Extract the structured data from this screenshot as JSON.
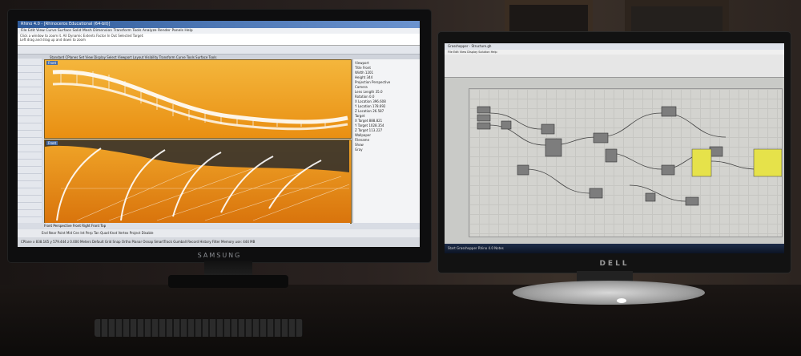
{
  "scene": {
    "description_type": "photo of two monitors on a desk",
    "left_monitor": {
      "brand": "SAMSUNG",
      "app_title": "Rhino 4.0 - [Rhinoceros Educational (64-bit)]",
      "menu": "File Edit View Curve Surface Solid Mesh Dimension Transform Tools Analyze Render Panels Help",
      "command_line_1": "Click a window to zoom it. All Dynamic Extents Factor In Out Selected Target:",
      "command_line_2": "Left drag and drag up and down to zoom",
      "command_label": "Command:",
      "tabs": "Standard  CPlanes  Set View  Display  Select  Viewport Layout  Visibility  Transform  Curve Tools  Surface Tools",
      "viewport_top_label": "Front",
      "viewport_bottom_label": "Front",
      "props_text": "Viewport\nTitle Front\nWidth 1201\nHeight 344\nProjection Perspective\nCamera\nLens Length 35.0\nRotation 0.0\nX Location 396.608\nY Location 178.692\nZ Location 26.587\nTarget\nX Target 888.821\nY Target 1028.354\nZ Target 113.227\nWallpaper\nFilename\nShow\nGray",
      "viewport_tabs": "Front  Perspective  Front  Right  Front  Top",
      "osnap_text": "End  Near  Point  Mid  Cen  Int  Perp  Tan  Quad  Knot  Vertex  Project  Disable",
      "status_text": "CPlane   x 838.165   y 579.444   z 0.000   Meters   Default   Grid Snap  Ortho  Planar  Osnap  SmartTrack  Gumball  Record History  Filter  Memory use: 444 MB"
    },
    "right_monitor": {
      "brand": "DELL",
      "app_title": "Grasshopper - Structure.gh",
      "menu": "File  Edit  View  Display  Solution  Help",
      "taskbar_text": "Start   Grasshopper   Rhino 4.0   Notes"
    }
  }
}
